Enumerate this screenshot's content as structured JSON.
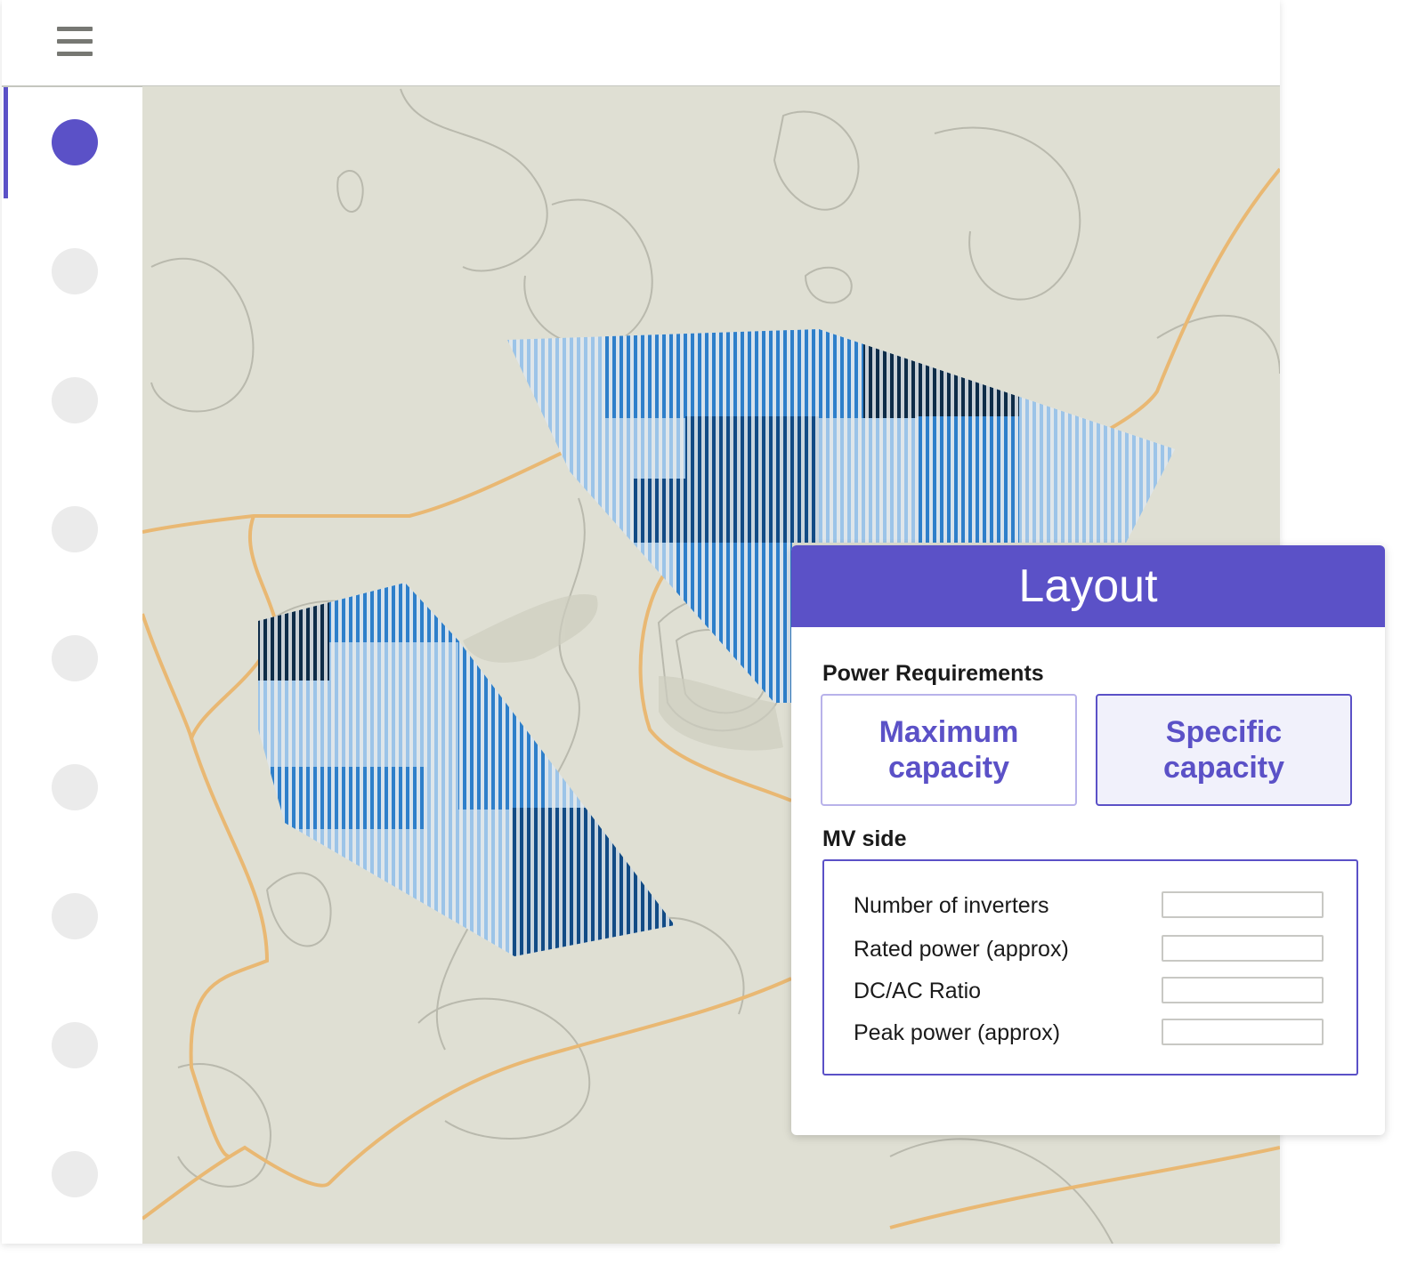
{
  "header": {
    "menu_icon": "hamburger-menu-icon"
  },
  "sidebar": {
    "items": [
      {
        "active": true
      },
      {
        "active": false
      },
      {
        "active": false
      },
      {
        "active": false
      },
      {
        "active": false
      },
      {
        "active": false
      },
      {
        "active": false
      },
      {
        "active": false
      },
      {
        "active": false
      }
    ]
  },
  "colors": {
    "accent": "#5b51c7",
    "map_bg": "#dfdfd3",
    "road": "#e9b873",
    "stripe_light": "#9cc4e8",
    "stripe_mid": "#2e7fca",
    "stripe_dark": "#124b85",
    "stripe_darkest": "#0e2c48"
  },
  "panel": {
    "title": "Layout",
    "power_requirements": {
      "label": "Power Requirements",
      "options": [
        {
          "label": "Maximum capacity",
          "selected": false
        },
        {
          "label": "Specific capacity",
          "selected": true
        }
      ]
    },
    "mv_side": {
      "label": "MV side",
      "fields": [
        {
          "label": "Number of inverters",
          "value": ""
        },
        {
          "label": "Rated power (approx)",
          "value": ""
        },
        {
          "label": "DC/AC Ratio",
          "value": ""
        },
        {
          "label": "Peak power (approx)",
          "value": ""
        }
      ]
    }
  }
}
